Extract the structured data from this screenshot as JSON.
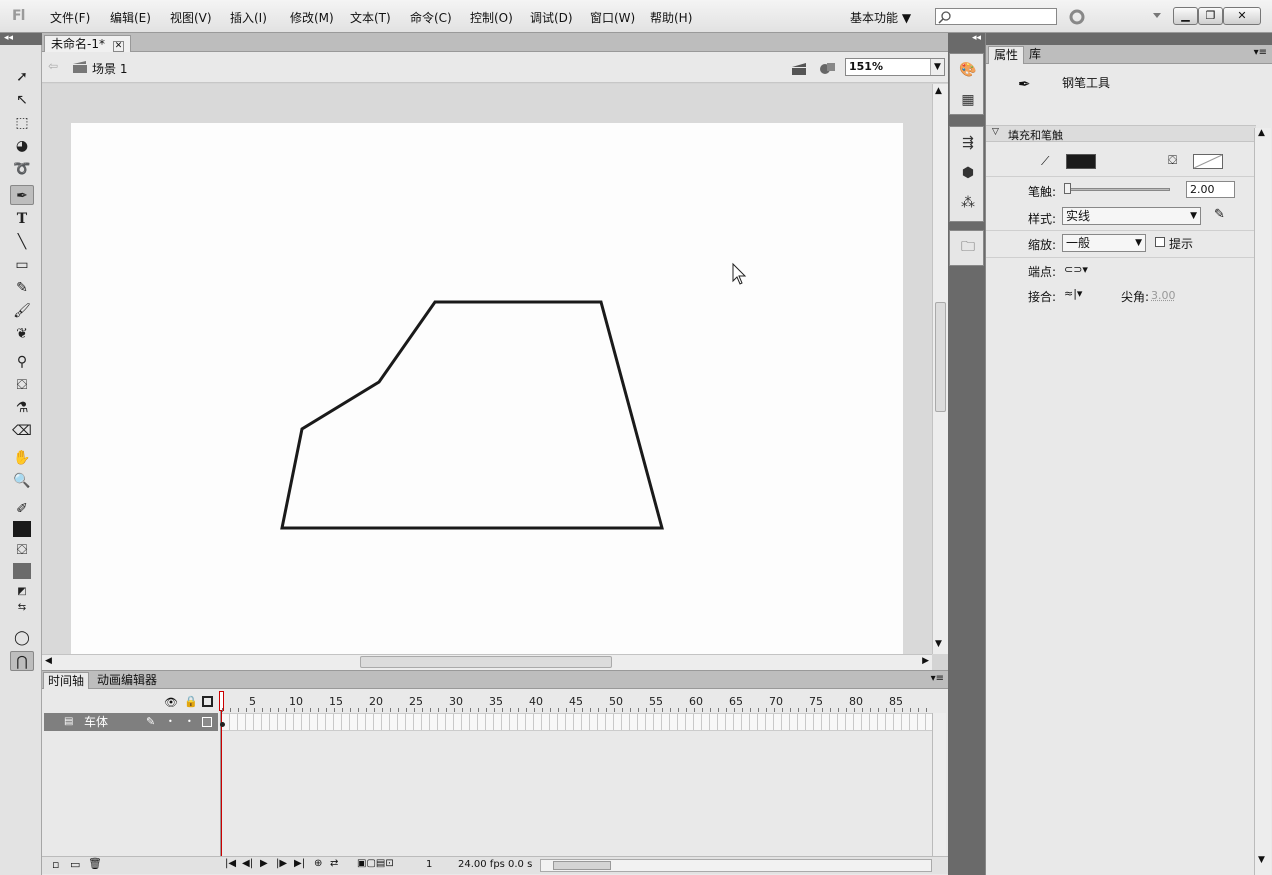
{
  "app": {
    "logo": "Fl"
  },
  "menu": [
    {
      "label": "文件(F)"
    },
    {
      "label": "编辑(E)"
    },
    {
      "label": "视图(V)"
    },
    {
      "label": "插入(I)"
    },
    {
      "label": "修改(M)"
    },
    {
      "label": "文本(T)"
    },
    {
      "label": "命令(C)"
    },
    {
      "label": "控制(O)"
    },
    {
      "label": "调试(D)"
    },
    {
      "label": "窗口(W)"
    },
    {
      "label": "帮助(H)"
    }
  ],
  "workspace": {
    "label": "基本功能 ▼"
  },
  "window_buttons": {
    "minimize": "▁",
    "restore": "❐",
    "close": "✕"
  },
  "document": {
    "tab": "未命名-1*",
    "close": "✕",
    "scene": "场景 1",
    "zoom": "151%"
  },
  "shape_color": "#1a1a1a",
  "timeline": {
    "tabs": [
      "时间轴",
      "动画编辑器"
    ],
    "ruler": [
      "5",
      "10",
      "15",
      "20",
      "25",
      "30",
      "35",
      "40",
      "45",
      "50",
      "55",
      "60",
      "65",
      "70",
      "75",
      "80",
      "85"
    ],
    "layer": "车体",
    "frame": "1",
    "fps": "24.00 fps",
    "time": "0.0 s"
  },
  "properties": {
    "tabs": [
      "属性",
      "库"
    ],
    "tool_name": "钢笔工具",
    "section": "填充和笔触",
    "stroke_label": "笔触:",
    "stroke_value": "2.00",
    "style_label": "样式:",
    "style_value": "实线",
    "scale_label": "缩放:",
    "scale_value": "一般",
    "hint_label": "提示",
    "cap_label": "端点:",
    "join_label": "接合:",
    "miter_label": "尖角:",
    "miter_value": "3.00"
  }
}
